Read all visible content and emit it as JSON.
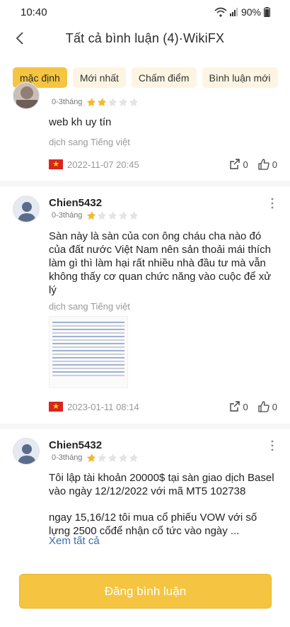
{
  "status": {
    "time": "10:40",
    "battery": "90%"
  },
  "header": {
    "title": "Tất cả bình luận (4)·WikiFX"
  },
  "tabs": [
    {
      "label": "mặc định",
      "active": true
    },
    {
      "label": "Mới nhất",
      "active": false
    },
    {
      "label": "Chấm điểm",
      "active": false
    },
    {
      "label": "Bình luận mới",
      "active": false
    }
  ],
  "comments": [
    {
      "duration": "0-3tháng",
      "rating": 2,
      "text": "web kh uy tín",
      "translate": "dịch sang Tiếng việt",
      "date": "2022-11-07 20:45",
      "shares": "0",
      "likes": "0"
    },
    {
      "username": "Chien5432",
      "duration": "0-3tháng",
      "rating": 1,
      "text": " Sàn này là sàn của con ông cháu cha nào đó của đất nước Việt Nam nên sản thoải mái thích làm gì thì làm hại rất nhiều nhà đầu tư mà vẫn không thấy cơ quan chức năng vào cuộc để xử lý",
      "translate": "dịch sang Tiếng việt",
      "date": "2023-01-11 08:14",
      "shares": "0",
      "likes": "0"
    },
    {
      "username": "Chien5432",
      "duration": "0-3tháng",
      "rating": 1,
      "text1": "Tôi lập tài khoản 20000$ tại sàn giao dịch Basel vào ngày 12/12/2022 với mã MT5 102738",
      "text2": "ngay 15,16/12 tôi mua cổ phiếu VOW với số lựng 2500 cổđể nhận cổ tức vào ngày ...",
      "readmore": "Xem tất cả"
    }
  ],
  "post_button": "Đăng bình luận",
  "colors": {
    "accent": "#f5c542",
    "link": "#3a6fb0"
  }
}
